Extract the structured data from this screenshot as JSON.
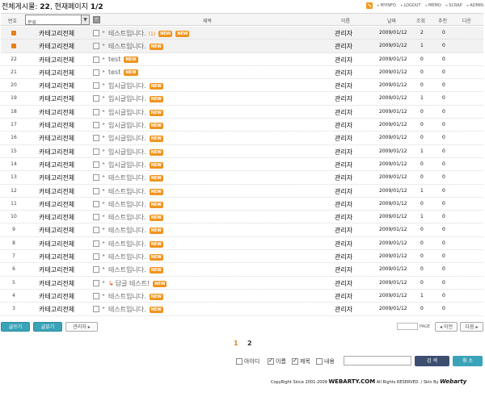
{
  "summary": {
    "prefix": "전체게시물: ",
    "total": "22",
    "sep": ",  현재페이지 ",
    "page": "1/2"
  },
  "toplinks": [
    "MYINFO",
    "LOGOUT",
    "MEMO",
    "SCRAP",
    "ADMIN"
  ],
  "header": {
    "no": "번호",
    "category": "분류",
    "title": "제목",
    "name": "이름",
    "date": "날짜",
    "hits": "조회",
    "recommend": "추천",
    "down": "다운"
  },
  "rows": [
    {
      "no": "",
      "notice": true,
      "category": "카테고리전체",
      "title": "테스트입니다.",
      "badge": "NEW",
      "comments": "(1)",
      "badge2": "NEW",
      "reply": false,
      "name": "관리자",
      "date": "2009/01/12",
      "hits": "2",
      "rec": "0"
    },
    {
      "no": "",
      "notice": true,
      "category": "카테고리전체",
      "title": "테스트입니다.",
      "badge": "NEW",
      "comments": "",
      "badge2": "",
      "reply": false,
      "name": "관리자",
      "date": "2009/01/12",
      "hits": "1",
      "rec": "0"
    },
    {
      "no": "22",
      "notice": false,
      "category": "카테고리전체",
      "title": "test",
      "badge": "NEW",
      "comments": "",
      "badge2": "",
      "reply": false,
      "name": "관리자",
      "date": "2009/01/12",
      "hits": "0",
      "rec": "0"
    },
    {
      "no": "21",
      "notice": false,
      "category": "카테고리전체",
      "title": "test",
      "badge": "NEW",
      "comments": "",
      "badge2": "",
      "reply": false,
      "name": "관리자",
      "date": "2009/01/12",
      "hits": "0",
      "rec": "0"
    },
    {
      "no": "20",
      "notice": false,
      "category": "카테고리전체",
      "title": "임시글입니다.",
      "badge": "NEW",
      "comments": "",
      "badge2": "",
      "reply": false,
      "name": "관리자",
      "date": "2009/01/12",
      "hits": "0",
      "rec": "0"
    },
    {
      "no": "19",
      "notice": false,
      "category": "카테고리전체",
      "title": "임시글입니다.",
      "badge": "NEW",
      "comments": "",
      "badge2": "",
      "reply": false,
      "name": "관리자",
      "date": "2009/01/12",
      "hits": "1",
      "rec": "0"
    },
    {
      "no": "18",
      "notice": false,
      "category": "카테고리전체",
      "title": "임시글입니다.",
      "badge": "NEW",
      "comments": "",
      "badge2": "",
      "reply": false,
      "name": "관리자",
      "date": "2009/01/12",
      "hits": "0",
      "rec": "0"
    },
    {
      "no": "17",
      "notice": false,
      "category": "카테고리전체",
      "title": "임시글입니다.",
      "badge": "NEW",
      "comments": "",
      "badge2": "",
      "reply": false,
      "name": "관리자",
      "date": "2009/01/12",
      "hits": "0",
      "rec": "0"
    },
    {
      "no": "16",
      "notice": false,
      "category": "카테고리전체",
      "title": "임시글입니다.",
      "badge": "NEW",
      "comments": "",
      "badge2": "",
      "reply": false,
      "name": "관리자",
      "date": "2009/01/12",
      "hits": "0",
      "rec": "0"
    },
    {
      "no": "15",
      "notice": false,
      "category": "카테고리전체",
      "title": "임시글입니다.",
      "badge": "NEW",
      "comments": "",
      "badge2": "",
      "reply": false,
      "name": "관리자",
      "date": "2009/01/12",
      "hits": "1",
      "rec": "0"
    },
    {
      "no": "14",
      "notice": false,
      "category": "카테고리전체",
      "title": "임시글입니다.",
      "badge": "NEW",
      "comments": "",
      "badge2": "",
      "reply": false,
      "name": "관리자",
      "date": "2009/01/12",
      "hits": "0",
      "rec": "0"
    },
    {
      "no": "13",
      "notice": false,
      "category": "카테고리전체",
      "title": "테스트입니다.",
      "badge": "NEW",
      "comments": "",
      "badge2": "",
      "reply": false,
      "name": "관리자",
      "date": "2009/01/12",
      "hits": "0",
      "rec": "0"
    },
    {
      "no": "12",
      "notice": false,
      "category": "카테고리전체",
      "title": "테스트입니다.",
      "badge": "NEW",
      "comments": "",
      "badge2": "",
      "reply": false,
      "name": "관리자",
      "date": "2009/01/12",
      "hits": "1",
      "rec": "0"
    },
    {
      "no": "11",
      "notice": false,
      "category": "카테고리전체",
      "title": "테스트입니다.",
      "badge": "NEW",
      "comments": "",
      "badge2": "",
      "reply": false,
      "name": "관리자",
      "date": "2009/01/12",
      "hits": "0",
      "rec": "0"
    },
    {
      "no": "10",
      "notice": false,
      "category": "카테고리전체",
      "title": "테스트입니다.",
      "badge": "NEW",
      "comments": "",
      "badge2": "",
      "reply": false,
      "name": "관리자",
      "date": "2009/01/12",
      "hits": "1",
      "rec": "0"
    },
    {
      "no": "9",
      "notice": false,
      "category": "카테고리전체",
      "title": "테스트입니다.",
      "badge": "NEW",
      "comments": "",
      "badge2": "",
      "reply": false,
      "name": "관리자",
      "date": "2009/01/12",
      "hits": "0",
      "rec": "0"
    },
    {
      "no": "8",
      "notice": false,
      "category": "카테고리전체",
      "title": "테스트입니다.",
      "badge": "NEW",
      "comments": "",
      "badge2": "",
      "reply": false,
      "name": "관리자",
      "date": "2009/01/12",
      "hits": "0",
      "rec": "0"
    },
    {
      "no": "7",
      "notice": false,
      "category": "카테고리전체",
      "title": "테스트입니다.",
      "badge": "NEW",
      "comments": "",
      "badge2": "",
      "reply": false,
      "name": "관리자",
      "date": "2009/01/12",
      "hits": "0",
      "rec": "0"
    },
    {
      "no": "6",
      "notice": false,
      "category": "카테고리전체",
      "title": "테스트입니다.",
      "badge": "NEW",
      "comments": "",
      "badge2": "",
      "reply": false,
      "name": "관리자",
      "date": "2009/01/12",
      "hits": "0",
      "rec": "0"
    },
    {
      "no": "5",
      "notice": false,
      "category": "카테고리전체",
      "title": "답글 테스트!",
      "badge": "NEW",
      "comments": "",
      "badge2": "",
      "reply": true,
      "name": "관리자",
      "date": "2009/01/12",
      "hits": "0",
      "rec": "0"
    },
    {
      "no": "4",
      "notice": false,
      "category": "카테고리전체",
      "title": "테스트입니다.",
      "badge": "NEW",
      "comments": "",
      "badge2": "",
      "reply": false,
      "name": "관리자",
      "date": "2009/01/12",
      "hits": "1",
      "rec": "0"
    },
    {
      "no": "3",
      "notice": false,
      "category": "카테고리전체",
      "title": "테스트입니다.",
      "badge": "NEW",
      "comments": "",
      "badge2": "",
      "reply": false,
      "name": "관리자",
      "date": "2009/01/12",
      "hits": "0",
      "rec": "0"
    }
  ],
  "actions": {
    "write": "글쓰기",
    "read": "글읽기",
    "admin": "관리자",
    "page_label": "PAGE",
    "prev": "이전",
    "next": "다음"
  },
  "pagination": {
    "current": "1",
    "other": "2"
  },
  "search": {
    "options": [
      {
        "label": "아이디",
        "checked": false
      },
      {
        "label": "이름",
        "checked": true
      },
      {
        "label": "제목",
        "checked": true
      },
      {
        "label": "내용",
        "checked": false
      }
    ],
    "query": "",
    "search_btn": "검 색",
    "cancel_btn": "취 소"
  },
  "footer": {
    "pre": "CopyRight Since 2001-2009 ",
    "brand": "WEBARTY.COM",
    "post": " All Rights RESERVED. / Skin By ",
    "sign": "Webarty"
  },
  "colors": {
    "accent_orange": "#f0941f",
    "button_teal": "#3aa3b8",
    "button_navy": "#3c4f70"
  }
}
